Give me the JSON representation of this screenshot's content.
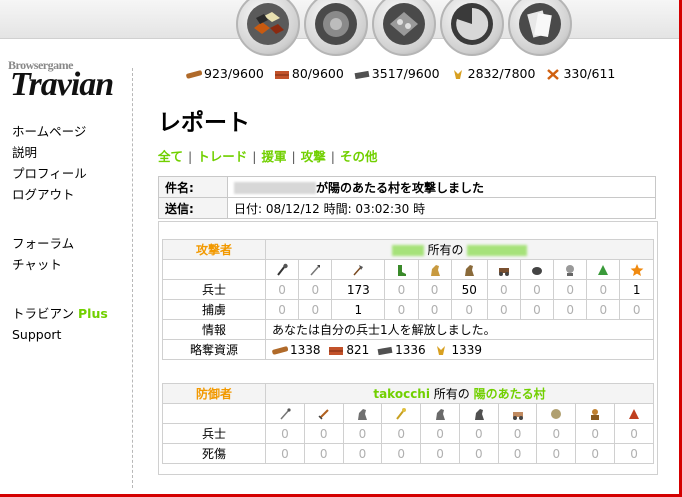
{
  "sidebar": {
    "logo_small": "Browsergame",
    "logo": "Travian",
    "menu1": [
      "ホームページ",
      "説明",
      "プロフィール",
      "ログアウト"
    ],
    "menu2": [
      "フォーラム",
      "チャット"
    ],
    "menu3_prefix": "トラビアン",
    "menu3_plus": "Plus",
    "menu3_support": "Support"
  },
  "resources": {
    "wood": "923/9600",
    "clay": "80/9600",
    "iron": "3517/9600",
    "crop": "2832/7800",
    "consumption": "330/611"
  },
  "page_title": "レポート",
  "filters": [
    "全て",
    "トレード",
    "援軍",
    "攻撃",
    "その他"
  ],
  "report": {
    "subject_label": "件名:",
    "subject_text": "が陽のあたる村を攻撃しました",
    "sent_label": "送信:",
    "sent_text": "日付: 08/12/12 時間: 03:02:30 時"
  },
  "attacker": {
    "role": "攻撃者",
    "owner_mid": "所有の",
    "row_soldiers": "兵士",
    "soldiers": [
      "0",
      "0",
      "173",
      "0",
      "0",
      "50",
      "0",
      "0",
      "0",
      "0",
      "1"
    ],
    "row_captured": "捕虜",
    "captured": [
      "0",
      "0",
      "1",
      "0",
      "0",
      "0",
      "0",
      "0",
      "0",
      "0",
      "0"
    ],
    "row_info": "情報",
    "info_text": "あなたは自分の兵士1人を解放しました。",
    "row_loot": "略奪資源",
    "loot": [
      "1338",
      "821",
      "1336",
      "1339"
    ]
  },
  "defender": {
    "role": "防御者",
    "player": "takocchi",
    "owner_mid": "所有の",
    "village": "陽のあたる村",
    "row_soldiers": "兵士",
    "soldiers": [
      "0",
      "0",
      "0",
      "0",
      "0",
      "0",
      "0",
      "0",
      "0",
      "0"
    ],
    "row_casualties": "死傷",
    "casualties": [
      "0",
      "0",
      "0",
      "0",
      "0",
      "0",
      "0",
      "0",
      "0",
      "0"
    ]
  },
  "colors": {
    "accent": "#71d000",
    "role": "#f29900",
    "frame": "#d40000"
  }
}
